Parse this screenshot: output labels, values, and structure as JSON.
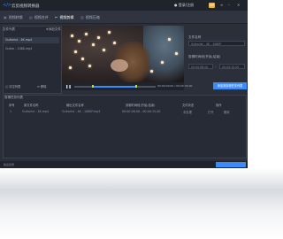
{
  "app": {
    "title": "云剪视频转换器",
    "register_label": "登录/注册",
    "vip_label": "VIP"
  },
  "tabs": [
    {
      "label": "视频转换",
      "icon": "convert-icon"
    },
    {
      "label": "视频合并",
      "icon": "merge-icon"
    },
    {
      "label": "视频剪辑",
      "icon": "cut-icon"
    },
    {
      "label": "视频压缩",
      "icon": "compress-icon"
    }
  ],
  "file_list": {
    "header": "文件列表",
    "add_label": "添加文件",
    "items": [
      "Guitarist - 4K.mp4",
      "Guitar - 1080.mp4"
    ],
    "clear_label": "清空列表",
    "remove_label": "移除"
  },
  "player": {
    "time": "00:00:00.00 / 00:00:30.00"
  },
  "settings": {
    "filename_label": "文件名称",
    "filename_value": "Guitarist - 4K - 1080P",
    "range_label": "剪辑时间段(开始-结束)",
    "start_value": "00:00:08.00",
    "end_value": "00:00:15.00",
    "start_button": "添加到剪辑任务列表"
  },
  "tasks": {
    "header": "剪辑任务列表",
    "columns": [
      "序号",
      "原文件名称",
      "输出文件名称",
      "剪辑时间段(开始-结束)",
      "文件状态",
      "操作"
    ],
    "rows": [
      {
        "index": "1",
        "source": "Guitarist - 4K.mp4",
        "output": "Guitarist - 4K - 1080P.mp4",
        "range": "00:00:08.00 - 00:00:15.00",
        "status": "未处理",
        "action1": "打开",
        "action2": "删除"
      }
    ]
  },
  "status": {
    "output_label": "输出目录"
  }
}
